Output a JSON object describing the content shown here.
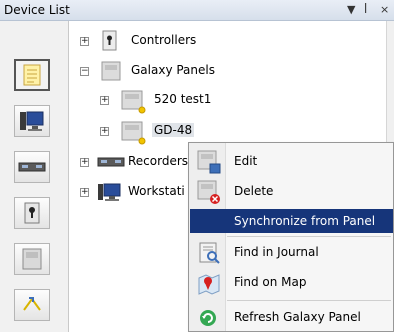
{
  "panel": {
    "title": "Device List",
    "header_icons": {
      "dropdown": "dropdown-arrow-icon",
      "pin": "pin-icon",
      "close": "close-icon"
    }
  },
  "sidebar": {
    "buttons": [
      {
        "icon": "notes-list-icon",
        "active": true
      },
      {
        "icon": "workstation-icon",
        "active": false
      },
      {
        "icon": "recorder-icon",
        "active": false
      },
      {
        "icon": "controller-keyhole-icon",
        "active": false
      },
      {
        "icon": "galaxy-panel-icon",
        "active": false
      },
      {
        "icon": "sync-arrows-icon",
        "active": false
      }
    ]
  },
  "tree": {
    "nodes": [
      {
        "label": "Controllers",
        "expander": "+",
        "icon": "controller-icon"
      },
      {
        "label": "Galaxy Panels",
        "expander": "−",
        "icon": "galaxy-panel-icon"
      },
      {
        "label": "520 test1",
        "expander": "+",
        "icon": "galaxy-panel-icon"
      },
      {
        "label": "GD-48",
        "expander": "+",
        "icon": "galaxy-panel-icon",
        "selected": true
      },
      {
        "label": "Recorders",
        "expander": "+",
        "icon": "recorder-icon"
      },
      {
        "label": "Workstati",
        "expander": "+",
        "icon": "workstation-icon"
      }
    ]
  },
  "context_menu": {
    "items": [
      {
        "label": "Edit",
        "icon": "edit-panel-icon",
        "highlighted": false
      },
      {
        "label": "Delete",
        "icon": "delete-panel-icon",
        "highlighted": false
      },
      {
        "label": "Synchronize from Panel",
        "icon": "",
        "highlighted": true
      },
      {
        "label": "Find in Journal",
        "icon": "journal-search-icon",
        "highlighted": false
      },
      {
        "label": "Find on Map",
        "icon": "map-pin-icon",
        "highlighted": false
      },
      {
        "label": "Refresh Galaxy Panel",
        "icon": "refresh-icon",
        "highlighted": false
      }
    ]
  },
  "colors": {
    "menu_highlight": "#16357a",
    "menu_background": "#f6f6f6",
    "selected_node": "#dfe3e8"
  }
}
